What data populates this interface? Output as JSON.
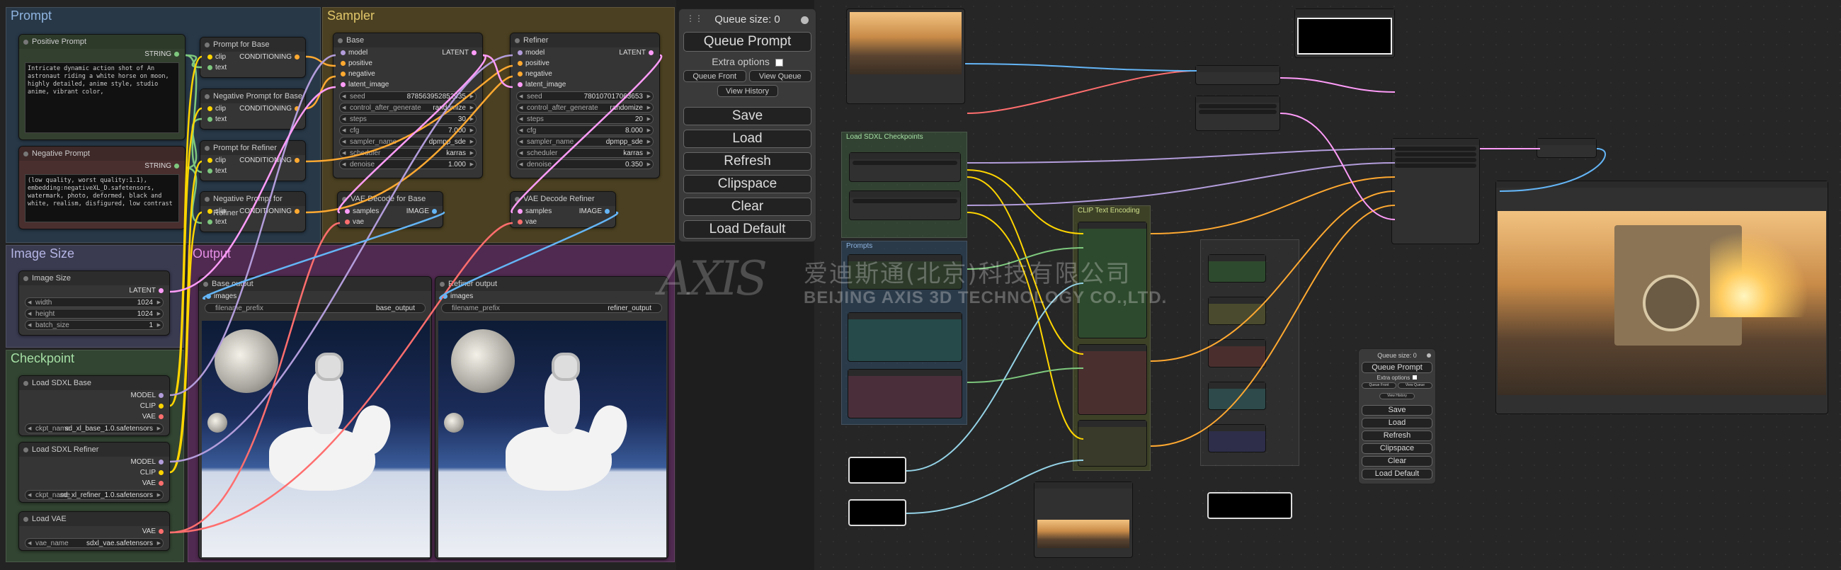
{
  "groups": {
    "prompt": "Prompt",
    "sampler": "Sampler",
    "image_size": "Image Size",
    "checkpoint": "Checkpoint",
    "output": "Output"
  },
  "nodes": {
    "positive_prompt": {
      "title": "Positive Prompt",
      "out": "STRING",
      "text": "Intricate dynamic action shot of An astronaut riding a white horse on moon, highly detailed, anime style, studio anime, vibrant color,"
    },
    "negative_prompt": {
      "title": "Negative Prompt",
      "out": "STRING",
      "text": "(low quality, worst quality:1.1), embedding:negativeXL_D.safetensors, watermark, photo, deformed, black and white, realism, disfigured, low contrast"
    },
    "prompt_base": {
      "title": "Prompt for Base",
      "in1": "clip",
      "in2": "text",
      "out": "CONDITIONING"
    },
    "neg_prompt_base": {
      "title": "Negative Prompt for Base",
      "in1": "clip",
      "in2": "text",
      "out": "CONDITIONING"
    },
    "prompt_refiner": {
      "title": "Prompt for Refiner",
      "in1": "clip",
      "in2": "text",
      "out": "CONDITIONING"
    },
    "neg_prompt_refiner": {
      "title": "Negative Prompt for Refiner",
      "in1": "clip",
      "in2": "text",
      "out": "CONDITIONING"
    },
    "base": {
      "title": "Base",
      "inputs": [
        "model",
        "positive",
        "negative",
        "latent_image"
      ],
      "out": "LATENT",
      "widgets": [
        {
          "name": "seed",
          "value": "878563952852935"
        },
        {
          "name": "control_after_generate",
          "value": "randomize"
        },
        {
          "name": "steps",
          "value": "30"
        },
        {
          "name": "cfg",
          "value": "7.000"
        },
        {
          "name": "sampler_name",
          "value": "dpmpp_sde"
        },
        {
          "name": "scheduler",
          "value": "karras"
        },
        {
          "name": "denoise",
          "value": "1.000"
        }
      ]
    },
    "refiner": {
      "title": "Refiner",
      "inputs": [
        "model",
        "positive",
        "negative",
        "latent_image"
      ],
      "out": "LATENT",
      "widgets": [
        {
          "name": "seed",
          "value": "780107017063653"
        },
        {
          "name": "control_after_generate",
          "value": "randomize"
        },
        {
          "name": "steps",
          "value": "20"
        },
        {
          "name": "cfg",
          "value": "8.000"
        },
        {
          "name": "sampler_name",
          "value": "dpmpp_sde"
        },
        {
          "name": "scheduler",
          "value": "karras"
        },
        {
          "name": "denoise",
          "value": "0.350"
        }
      ]
    },
    "vae_decode_base": {
      "title": "VAE Decode for Base",
      "in1": "samples",
      "in2": "vae",
      "out": "IMAGE"
    },
    "vae_decode_refiner": {
      "title": "VAE Decode Refiner",
      "in1": "samples",
      "in2": "vae",
      "out": "IMAGE"
    },
    "image_size": {
      "title": "Image Size",
      "out": "LATENT",
      "widgets": [
        {
          "name": "width",
          "value": "1024"
        },
        {
          "name": "height",
          "value": "1024"
        },
        {
          "name": "batch_size",
          "value": "1"
        }
      ]
    },
    "load_sdxl_base": {
      "title": "Load SDXL Base",
      "outs": [
        "MODEL",
        "CLIP",
        "VAE"
      ],
      "ckpt_label": "ckpt_name",
      "ckpt": "sd_xl_base_1.0.safetensors"
    },
    "load_sdxl_refiner": {
      "title": "Load SDXL Refiner",
      "outs": [
        "MODEL",
        "CLIP",
        "VAE"
      ],
      "ckpt_label": "ckpt_name",
      "ckpt": "sd_xl_refiner_1.0.safetensors"
    },
    "load_vae": {
      "title": "Load VAE",
      "out": "VAE",
      "label": "vae_name",
      "value": "sdxl_vae.safetensors"
    },
    "base_output": {
      "title": "Base output",
      "in": "images",
      "label": "filename_prefix",
      "value": "base_output"
    },
    "refiner_output": {
      "title": "Refiner output",
      "in": "images",
      "label": "filename_prefix",
      "value": "refiner_output"
    }
  },
  "queue_panel": {
    "size_label": "Queue size: 0",
    "queue_prompt": "Queue Prompt",
    "extra_options": "Extra options",
    "queue_front": "Queue Front",
    "view_queue": "View Queue",
    "view_history": "View History",
    "save": "Save",
    "load": "Load",
    "refresh": "Refresh",
    "clipspace": "Clipspace",
    "clear": "Clear",
    "load_default": "Load Default"
  },
  "watermark": {
    "cn": "爱迪斯通(北京)科技有限公司",
    "en": "BEIJING AXIS 3D TECHNOLOGY CO.,LTD."
  },
  "right_view": {
    "groups": [
      "Load SDXL Checkpoints",
      "Prompts",
      "CLIP Text Encoding"
    ],
    "queue_panel": {
      "size_label": "Queue size: 0",
      "queue_prompt": "Queue Prompt",
      "extra_options": "Extra options",
      "queue_front": "Queue Front",
      "view_queue": "View Queue",
      "view_history": "View History",
      "save": "Save",
      "load": "Load",
      "refresh": "Refresh",
      "clipspace": "Clipspace",
      "clear": "Clear",
      "load_default": "Load Default"
    }
  },
  "colors": {
    "prompt_group": "#2e4a66",
    "sampler_group": "#6e5a20",
    "image_size_group": "#4a4a6e",
    "checkpoint_group": "#3c5a3c",
    "output_group": "#6e2e6e",
    "pin_clip": "#ffd500",
    "pin_conditioning": "#ffa931",
    "pin_latent": "#ff9cf9",
    "pin_model": "#b39ddb",
    "pin_vae": "#ff6e6e",
    "pin_image": "#64b5f6",
    "pin_string": "#7ec87e"
  }
}
